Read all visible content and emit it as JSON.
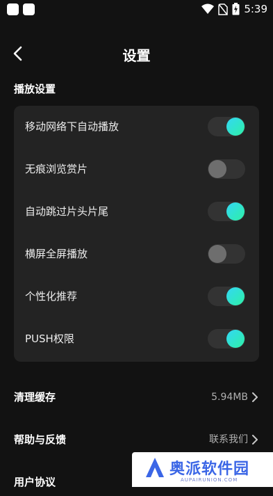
{
  "status_bar": {
    "time": "5:39",
    "icons": [
      "wifi-icon",
      "no-sim-icon",
      "battery-charging-icon"
    ]
  },
  "header": {
    "title": "设置",
    "back_icon": "chevron-left-icon"
  },
  "playback": {
    "section_title": "播放设置",
    "items": [
      {
        "label": "移动网络下自动播放",
        "enabled": true
      },
      {
        "label": "无痕浏览赏片",
        "enabled": false
      },
      {
        "label": "自动跳过片头片尾",
        "enabled": true
      },
      {
        "label": "横屏全屏播放",
        "enabled": false
      },
      {
        "label": "个性化推荐",
        "enabled": true
      },
      {
        "label": "PUSH权限",
        "enabled": true
      }
    ]
  },
  "general": {
    "items": [
      {
        "label": "清理缓存",
        "value": "5.94MB"
      },
      {
        "label": "帮助与反馈",
        "value": "联系我们"
      },
      {
        "label": "用户协议",
        "value": ""
      }
    ]
  },
  "watermark": {
    "text": "奥派软件园",
    "subtext": "AUPAIRUNION.COM"
  },
  "colors": {
    "background": "#121212",
    "card": "#232323",
    "toggle_on_start": "#33d7f5",
    "toggle_on_end": "#2ef0a6",
    "toggle_off_knob": "#6e6e6e"
  }
}
